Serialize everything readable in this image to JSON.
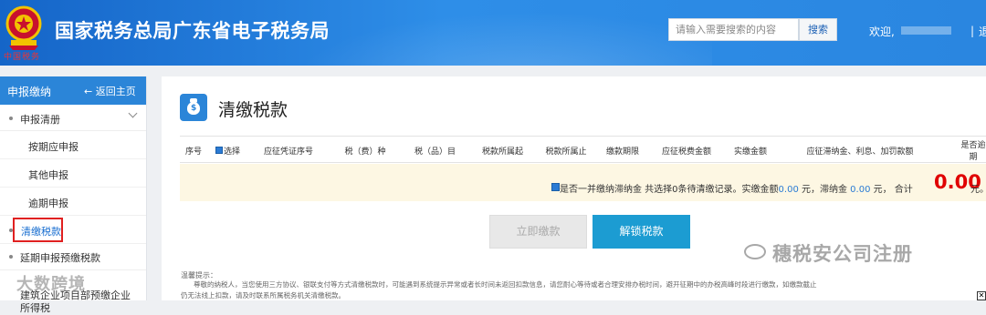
{
  "header": {
    "site_title": "国家税务总局广东省电子税务局",
    "emblem_caption": "中国税务",
    "search_placeholder": "请输入需要搜索的内容",
    "search_button": "搜索",
    "welcome": "欢迎,",
    "divider": "|",
    "more": "退"
  },
  "sidebar": {
    "title": "申报缴纳",
    "back": "返回主页",
    "group1": "申报清册",
    "items": [
      "按期应申报",
      "其他申报",
      "逾期申报",
      "清缴税款"
    ],
    "group2": "延期申报预缴税款",
    "cut1": "建筑企业项目部预缴企业",
    "cut2": "所得税",
    "watermark": "大数跨境"
  },
  "main": {
    "title": "清缴税款",
    "columns": [
      "序号",
      "选择",
      "应征凭证序号",
      "税（费）种",
      "税（品）目",
      "税款所属起",
      "税款所属止",
      "缴款期限",
      "应征税费金额",
      "实缴金额",
      "应征滞纳金、利息、加罚款额",
      "是否逾期"
    ],
    "notice": {
      "text1": "是否一并缴纳滞纳金  共选择0条待清缴记录。实缴金额",
      "amount1": "0.00",
      "text2": " 元，滞纳金 ",
      "amount2": "0.00",
      "text3": " 元，  合计",
      "total": "0.00",
      "unit": "元。"
    },
    "btn_pay": "立即缴款",
    "btn_unlock": "解锁税款",
    "tip_title": "温馨提示：",
    "tip_line1": "尊敬的纳税人，当您使用三方协议、银联支付等方式清缴税款时，可能遇到系统提示异常或者长时间未返回扣款信息，请您耐心等待或者合理安排办税时间，避开征期中的办税高峰时段进行缴款，如缴款截止",
    "tip_line2": "仍无法线上扣款，请及时联系所属税务机关清缴税款。",
    "watermark": "穗税安公司注册"
  },
  "colors": {
    "header_blue": "#1565c8",
    "accent": "#2b85d8",
    "unlock_button": "#1c9cd2",
    "total_red": "#e00000",
    "highlight_box": "#e02020"
  }
}
